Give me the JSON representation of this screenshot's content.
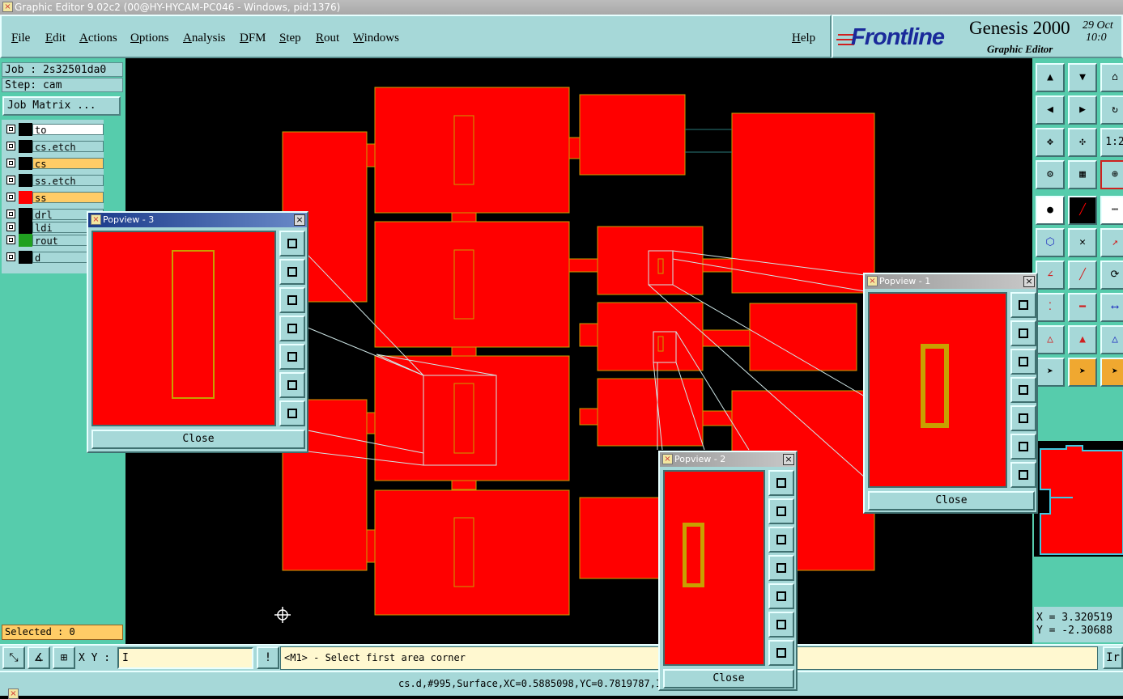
{
  "window": {
    "title": "Graphic Editor 9.02c2 (00@HY-HYCAM-PC046 - Windows, pid:1376)"
  },
  "menu": [
    "File",
    "Edit",
    "Actions",
    "Options",
    "Analysis",
    "DFM",
    "Step",
    "Rout",
    "Windows"
  ],
  "help_label": "Help",
  "logo": {
    "brand": "Frontline",
    "product": "Genesis 2000",
    "subtitle": "Graphic Editor",
    "date_line1": "29 Oct",
    "date_line2": "10:0"
  },
  "job": {
    "label": "Job : 2s32501da0",
    "step": "Step: cam",
    "matrix_button": "Job Matrix ..."
  },
  "layers": [
    {
      "name": "to",
      "color": "#ffffff",
      "swatch": "#000000"
    },
    {
      "name": "cs.etch",
      "color": "#a6d8d8",
      "swatch": "#000000"
    },
    {
      "name": "cs",
      "color": "#ffcc66",
      "swatch": "#000000"
    },
    {
      "name": "ss.etch",
      "color": "#a6d8d8",
      "swatch": "#000000"
    },
    {
      "name": "ss",
      "color": "#ffcc66",
      "swatch": "#ff0000"
    },
    {
      "name": "drl",
      "color": "#a6d8d8",
      "swatch": "#000000"
    },
    {
      "name": "ldi",
      "color": "#a6d8d8",
      "swatch": "#000000"
    },
    {
      "name": "rout",
      "color": "#a6d8d8",
      "swatch": "#20a020"
    },
    {
      "name": "d",
      "color": "#a6d8d8",
      "swatch": "#000000"
    }
  ],
  "selected": "Selected : 0",
  "xy_label": "X Y :",
  "xy_value": "I",
  "prompt": "<M1> - Select first area corner",
  "status": "cs.d,#995,Surface,XC=0.5885098,YC=0.7819787,Is",
  "coords": {
    "x": "X = 3.320519",
    "y": "Y = -2.30688"
  },
  "right_cut_button": "Ir",
  "toolbar_labels": {
    "one_to_two": "1:2"
  },
  "popviews": [
    {
      "title": "Popview - 3",
      "close": "Close"
    },
    {
      "title": "Popview - 1",
      "close": "Close"
    },
    {
      "title": "Popview - 2",
      "close": "Close"
    }
  ],
  "colors": {
    "pad": "#ff0000",
    "outline": "#c8a000",
    "panel": "#a6d8d8",
    "accent": "#56ccac"
  }
}
